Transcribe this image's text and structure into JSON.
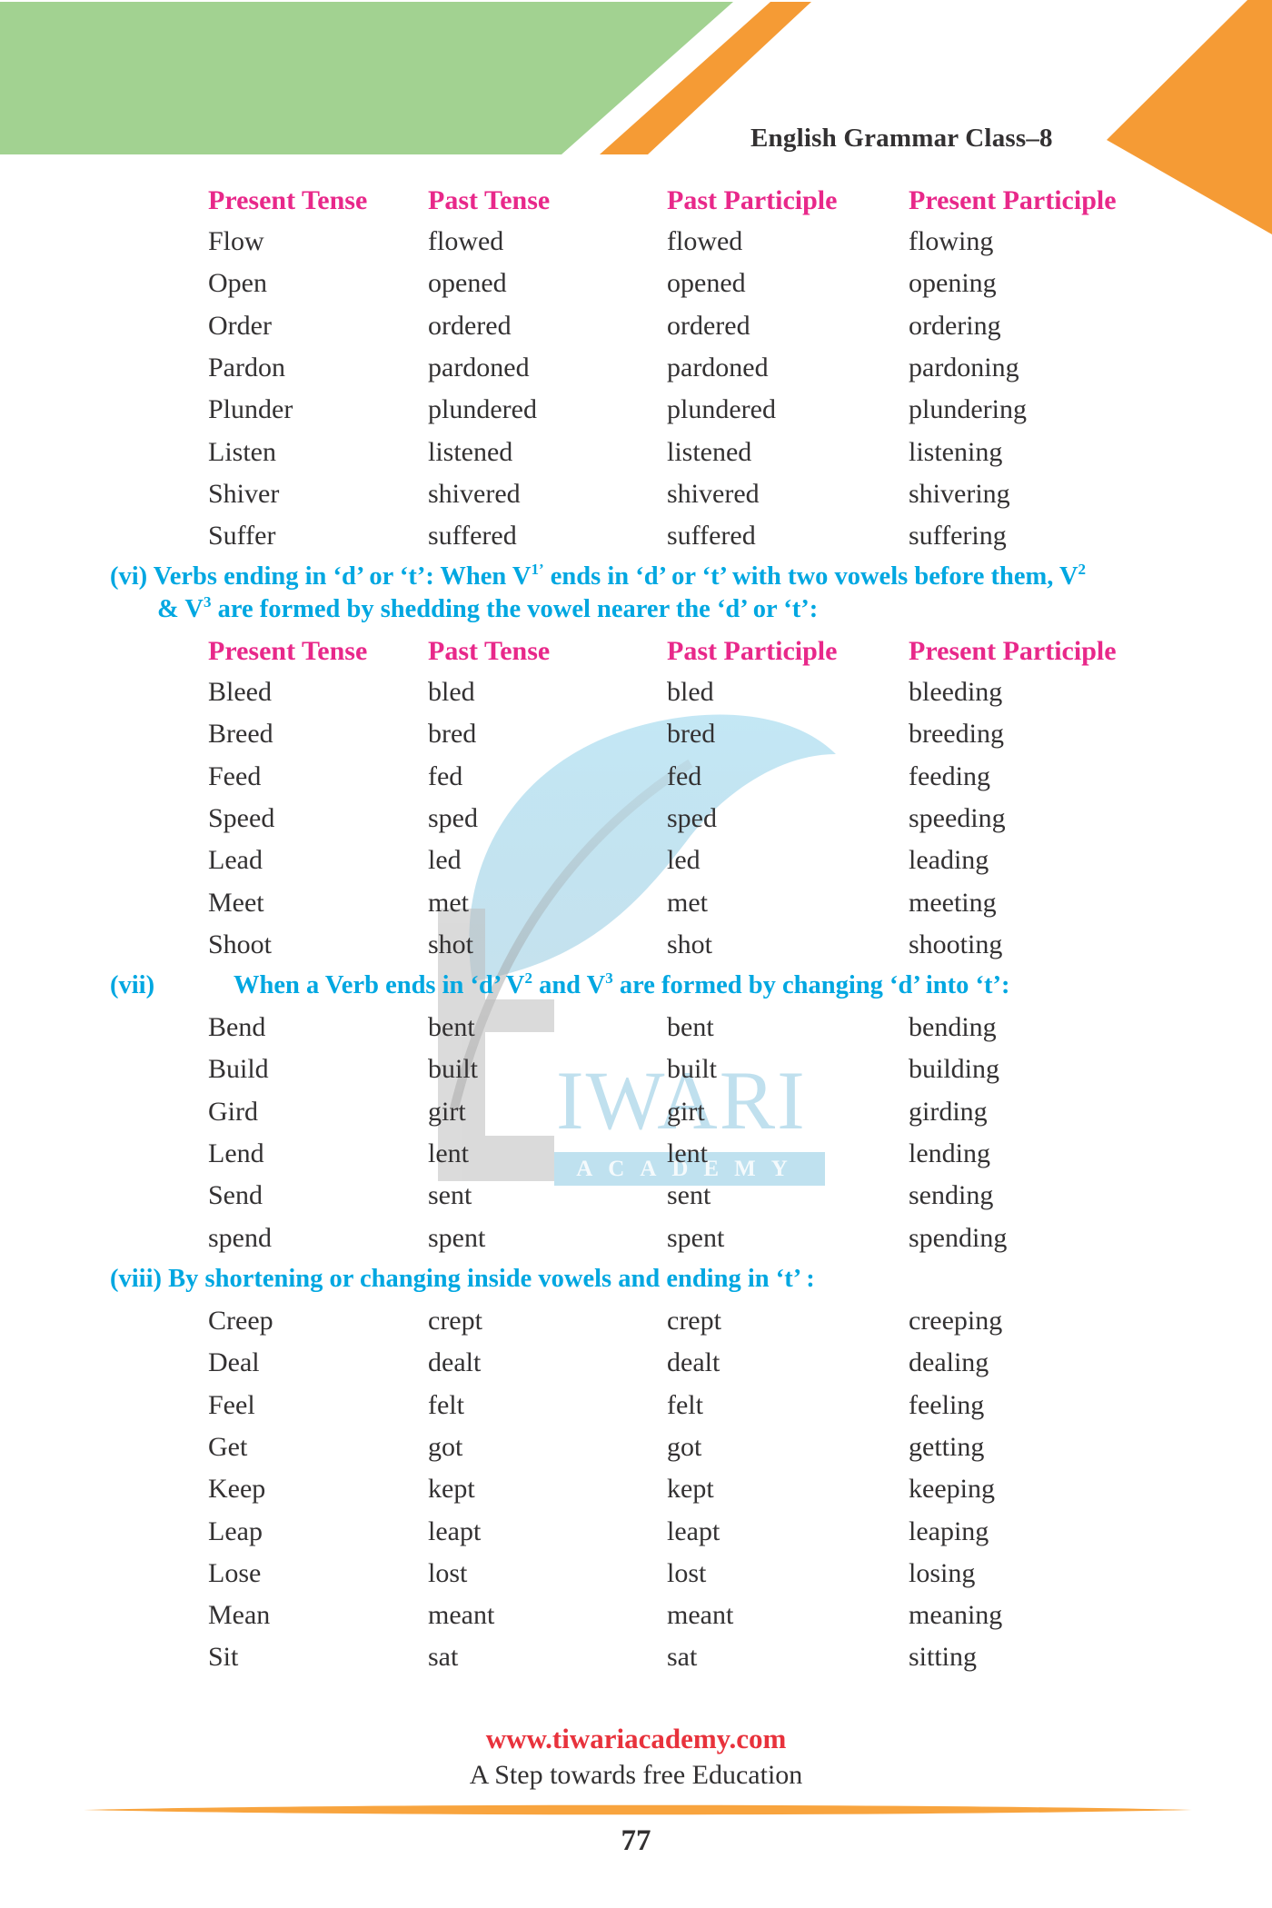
{
  "header": {
    "title": "English Grammar Class–8"
  },
  "colors": {
    "green_banner": "#a2d291",
    "orange_accent": "#f59b35",
    "column_header_pink": "#e8288a",
    "section_heading_blue": "#00a7e1",
    "body_text": "#333132",
    "url_red": "#e8323c"
  },
  "columns": [
    "Present Tense",
    "Past Tense",
    "Past Participle",
    "Present Participle"
  ],
  "table1": {
    "rows": [
      [
        "Flow",
        "flowed",
        "flowed",
        "flowing"
      ],
      [
        "Open",
        "opened",
        "opened",
        "opening"
      ],
      [
        "Order",
        "ordered",
        "ordered",
        "ordering"
      ],
      [
        "Pardon",
        "pardoned",
        "pardoned",
        "pardoning"
      ],
      [
        "Plunder",
        "plundered",
        "plundered",
        "plundering"
      ],
      [
        "Listen",
        "listened",
        "listened",
        "listening"
      ],
      [
        "Shiver",
        "shivered",
        "shivered",
        "shivering"
      ],
      [
        "Suffer",
        "suffered",
        "suffered",
        "suffering"
      ]
    ]
  },
  "section_vi": {
    "number": "(vi)",
    "line1_a": "Verbs ending in ‘d’ or ‘t’: When V",
    "line1_sup1": "1’",
    "line1_b": " ends in ‘d’ or ‘t’ with two vowels before them, V",
    "line1_sup2": "2",
    "line2_a": "& V",
    "line2_sup": "3",
    "line2_b": " are formed by shedding the vowel nearer the ‘d’ or ‘t’:",
    "rows": [
      [
        "Bleed",
        "bled",
        "bled",
        "bleeding"
      ],
      [
        "Breed",
        "bred",
        "bred",
        "breeding"
      ],
      [
        "Feed",
        "fed",
        "fed",
        "feeding"
      ],
      [
        "Speed",
        "sped",
        "sped",
        "speeding"
      ],
      [
        "Lead",
        "led",
        "led",
        "leading"
      ],
      [
        "Meet",
        "met",
        "met",
        "meeting"
      ],
      [
        "Shoot",
        "shot",
        "shot",
        "shooting"
      ]
    ]
  },
  "section_vii": {
    "number": "(vii)",
    "text_a": "When a Verb ends in ‘d’ V",
    "sup1": "2",
    "text_b": " and V",
    "sup2": "3",
    "text_c": " are formed by changing ‘d’ into ‘t’:",
    "rows": [
      [
        "Bend",
        "bent",
        "bent",
        "bending"
      ],
      [
        "Build",
        "built",
        "built",
        "building"
      ],
      [
        "Gird",
        "girt",
        "girt",
        "girding"
      ],
      [
        "Lend",
        "lent",
        "lent",
        "lending"
      ],
      [
        "Send",
        "sent",
        "sent",
        "sending"
      ],
      [
        "spend",
        "spent",
        "spent",
        "spending"
      ]
    ]
  },
  "section_viii": {
    "number": "(viii)",
    "text": "By shortening or changing inside vowels and ending in ‘t’ :",
    "rows": [
      [
        "Creep",
        "crept",
        "crept",
        "creeping"
      ],
      [
        "Deal",
        "dealt",
        "dealt",
        "dealing"
      ],
      [
        "Feel",
        "felt",
        "felt",
        "feeling"
      ],
      [
        "Get",
        "got",
        "got",
        "getting"
      ],
      [
        "Keep",
        "kept",
        "kept",
        "keeping"
      ],
      [
        "Leap",
        "leapt",
        "leapt",
        "leaping"
      ],
      [
        "Lose",
        "lost",
        "lost",
        "losing"
      ],
      [
        "Mean",
        "meant",
        "meant",
        "meaning"
      ],
      [
        "Sit",
        "sat",
        "sat",
        "sitting"
      ]
    ]
  },
  "watermark": {
    "logo_letter": "t",
    "name": "IWARI",
    "subtitle": "ACADEMY"
  },
  "footer": {
    "url": "www.tiwariacademy.com",
    "tagline": "A Step towards free Education",
    "page_number": "77"
  }
}
